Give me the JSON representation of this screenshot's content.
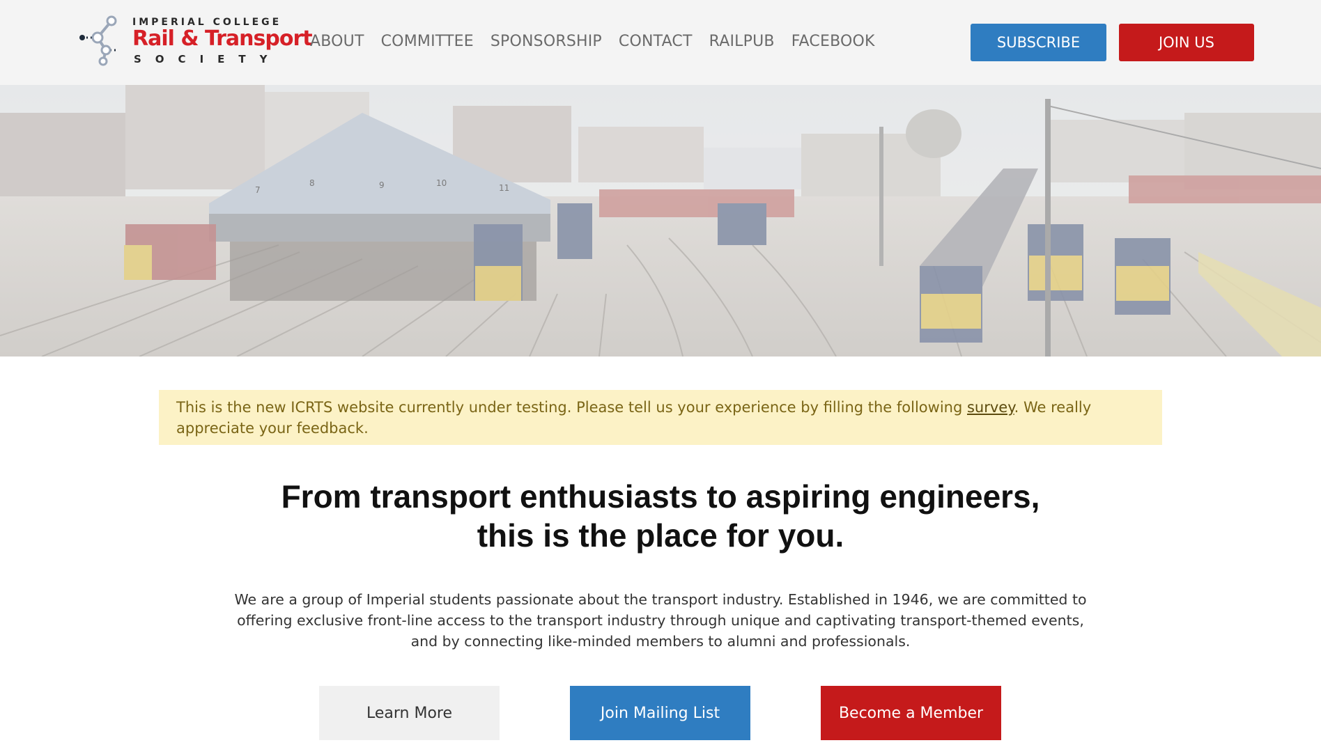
{
  "logo": {
    "top": "IMPERIAL COLLEGE",
    "main": "Rail & Transport",
    "bottom": "SOCIETY"
  },
  "nav": {
    "items": [
      "ABOUT",
      "COMMITTEE",
      "SPONSORSHIP",
      "CONTACT",
      "RAILPUB",
      "FACEBOOK"
    ]
  },
  "header_buttons": {
    "subscribe": "SUBSCRIBE",
    "join": "JOIN US"
  },
  "notice": {
    "before": "This is the new ICRTS website currently under testing. Please tell us your experience by filling the following ",
    "link": "survey",
    "after": ". We really appreciate your feedback."
  },
  "headline": {
    "line1": "From transport enthusiasts to aspiring engineers,",
    "line2": "this is the place for you."
  },
  "intro": "We are a group of Imperial students passionate about the transport industry. Established in 1946, we are committed to offering exclusive front-line access to the transport industry through unique and captivating transport-themed events, and by connecting like-minded members to alumni and professionals.",
  "cta": {
    "learn": "Learn More",
    "mailing": "Join Mailing List",
    "member": "Become a Member"
  },
  "hero": {
    "shed_numbers": [
      "7",
      "8",
      "9",
      "10",
      "11"
    ]
  },
  "colors": {
    "blue": "#2f7dc1",
    "red": "#c51a1b",
    "notice_bg": "#fcf2c6",
    "header_bg": "#f4f4f4"
  }
}
